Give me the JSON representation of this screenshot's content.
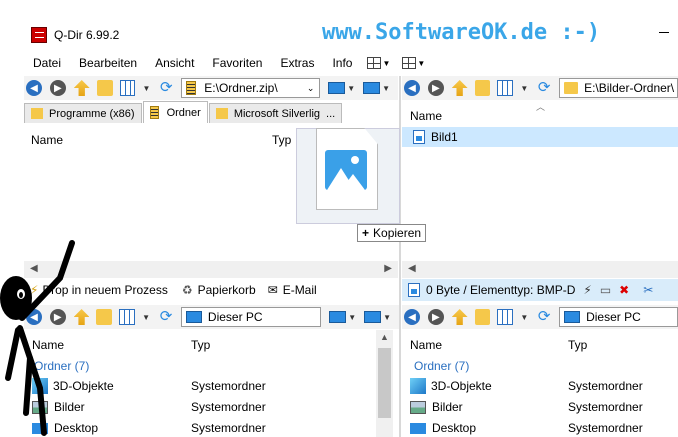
{
  "window": {
    "title": "Q-Dir 6.99.2",
    "watermark": "www.SoftwareOK.de :-)"
  },
  "menu": {
    "items": [
      "Datei",
      "Bearbeiten",
      "Ansicht",
      "Favoriten",
      "Extras",
      "Info"
    ]
  },
  "pane_top_left": {
    "address": "E:\\Ordner.zip\\",
    "tabs": [
      "Programme (x86)",
      "Ordner",
      "Microsoft Silverlig"
    ],
    "col_name": "Name",
    "col_type": "Typ"
  },
  "pane_top_right": {
    "address": "E:\\Bilder-Ordner\\",
    "col_name": "Name",
    "files": [
      {
        "name": "Bild1"
      }
    ]
  },
  "drag": {
    "copy_label": "Kopieren"
  },
  "status_left": {
    "items": [
      "Drop in neuem Prozess",
      "Papierkorb",
      "E-Mail"
    ]
  },
  "status_right": {
    "text": "0 Byte / Elementtyp: BMP-D"
  },
  "pane_bottom_left": {
    "address": "Dieser PC",
    "col_name": "Name",
    "col_type": "Typ",
    "group": "Ordner (7)",
    "rows": [
      {
        "name": "3D-Objekte",
        "type": "Systemordner"
      },
      {
        "name": "Bilder",
        "type": "Systemordner"
      },
      {
        "name": "Desktop",
        "type": "Systemordner"
      }
    ]
  },
  "pane_bottom_right": {
    "address": "Dieser PC",
    "col_name": "Name",
    "col_type": "Typ",
    "group": "Ordner (7)",
    "rows": [
      {
        "name": "3D-Objekte",
        "type": "Systemordner"
      },
      {
        "name": "Bilder",
        "type": "Systemordner"
      },
      {
        "name": "Desktop",
        "type": "Systemordner"
      }
    ]
  },
  "colors": {
    "accent": "#2a6fc0",
    "watermark": "#3aa6e8",
    "selection": "#cce8ff"
  }
}
